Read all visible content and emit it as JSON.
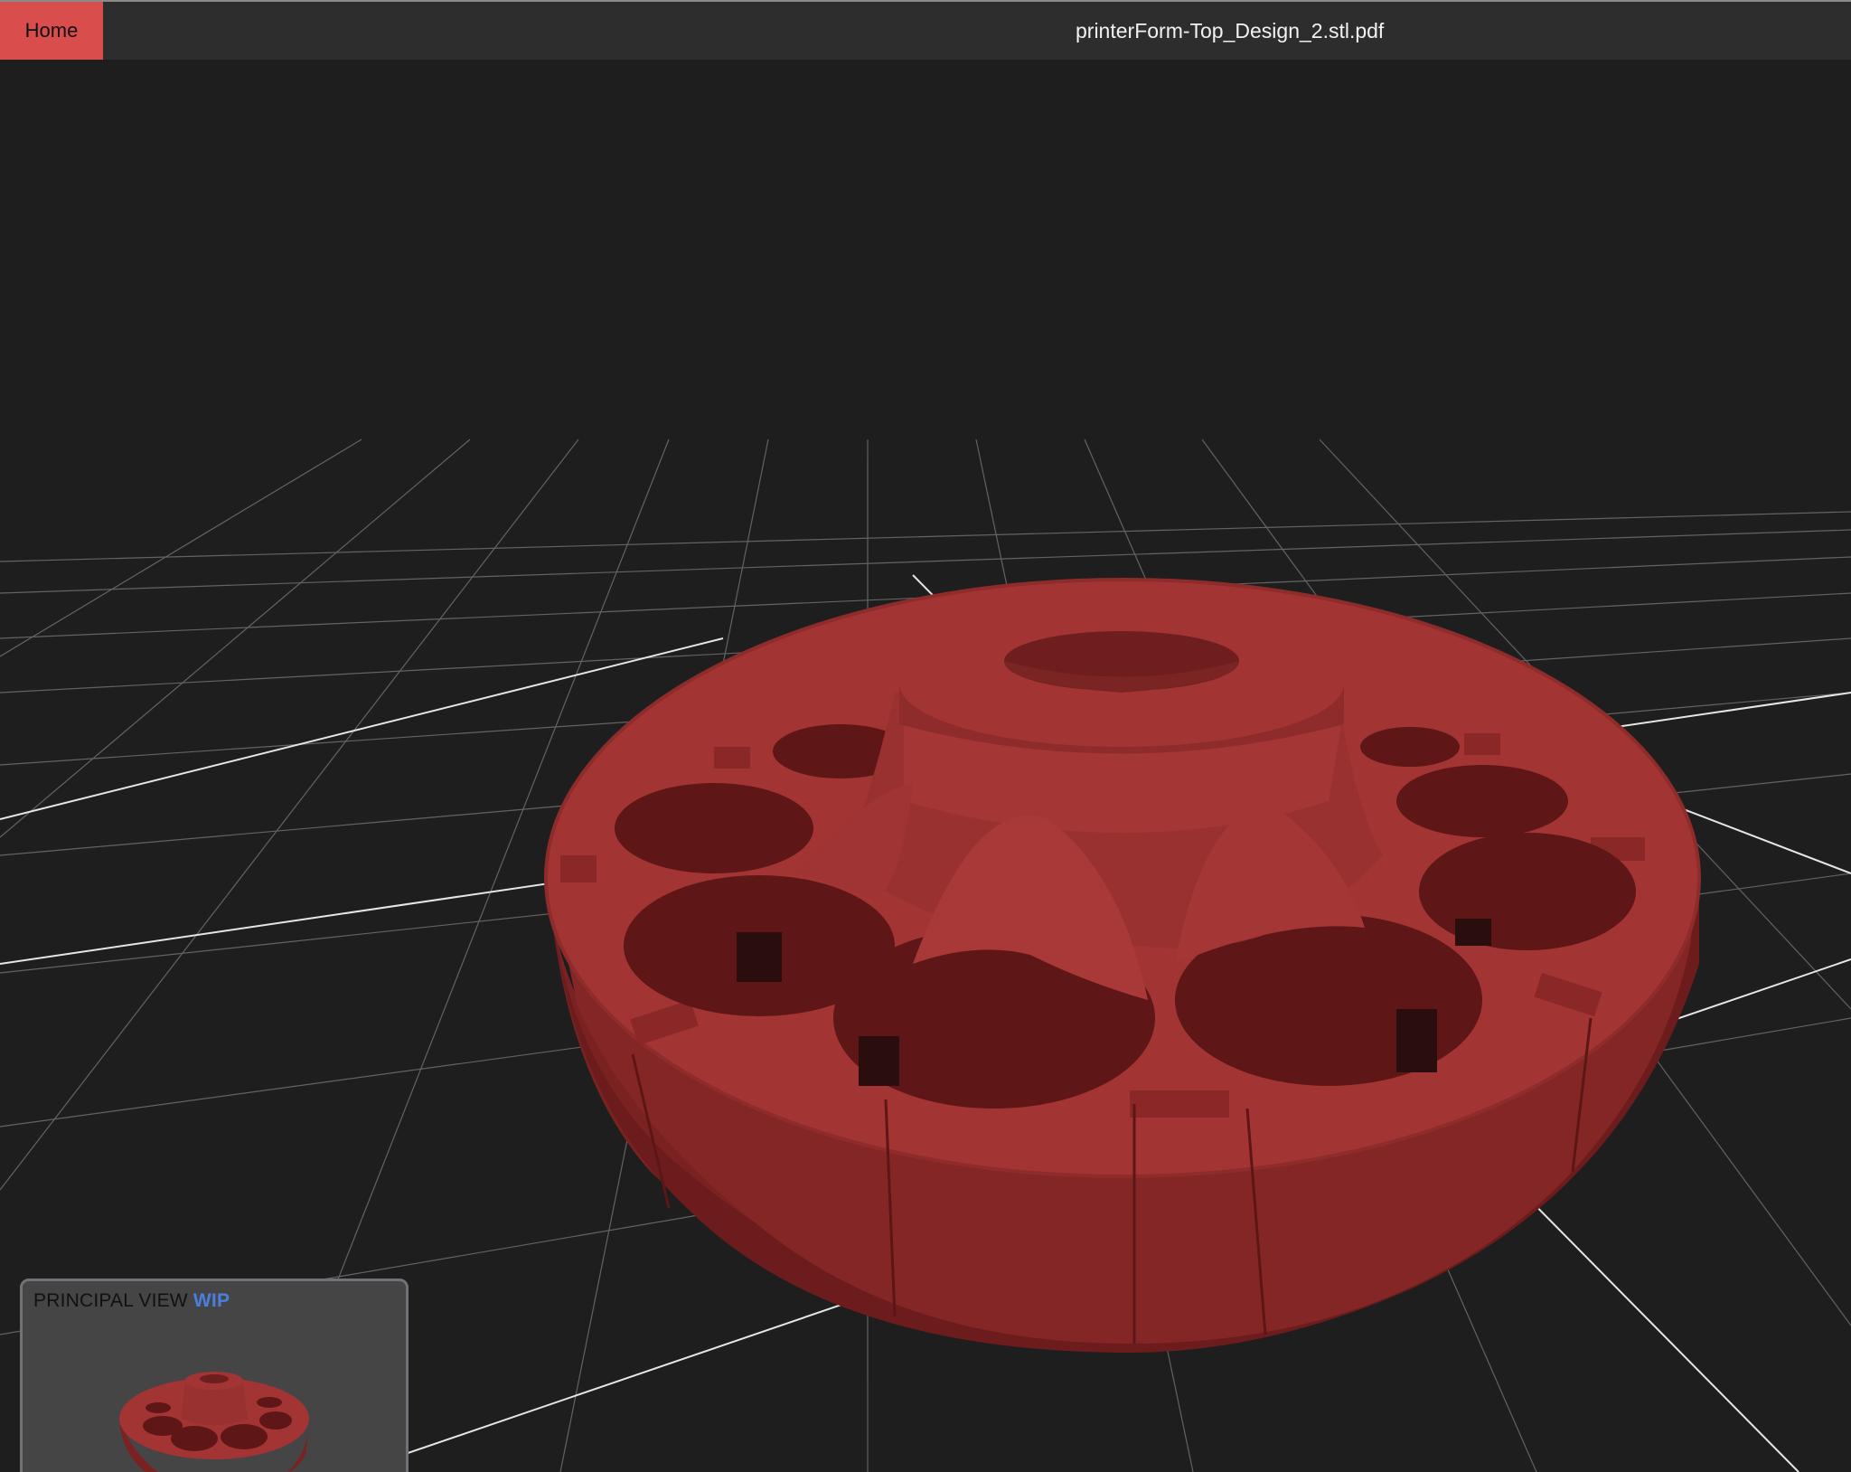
{
  "header": {
    "home_label": "Home",
    "file_name": "printerForm-Top_Design_2.stl.pdf"
  },
  "viewer": {
    "model_color": "#a33434",
    "background_color": "#1e1e1e",
    "grid_color": "#8a8a8a",
    "grid_visible": true
  },
  "thumbnail": {
    "view_label": "PRINCIPAL VIEW",
    "status_badge": "WIP",
    "badge_color": "#4a7fe0"
  },
  "colors": {
    "home_button": "#d94d4d",
    "topbar": "#2d2d2d",
    "panel": "#454545"
  }
}
